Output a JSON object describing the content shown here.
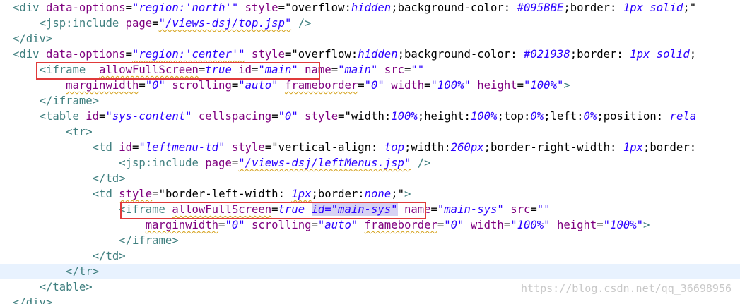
{
  "colors": {
    "tag": "#3f7f7f",
    "attribute": "#7f007f",
    "string": "#2a00ff",
    "highlight_box": "#e03a3a",
    "current_line": "#e8f2fe",
    "selection": "#d7d2f3"
  },
  "lines": [
    {
      "segments": [
        {
          "t": "<div",
          "c": "tag"
        },
        {
          "t": " "
        },
        {
          "t": "data-options",
          "c": "attr"
        },
        {
          "t": "="
        },
        {
          "t": "\"region:'north'\"",
          "c": "str"
        },
        {
          "t": " "
        },
        {
          "t": "style",
          "c": "attr"
        },
        {
          "t": "=\"overflow:"
        },
        {
          "t": "hidden",
          "c": "str"
        },
        {
          "t": ";background-color: "
        },
        {
          "t": "#095BBE",
          "c": "str"
        },
        {
          "t": ";border: "
        },
        {
          "t": "1px",
          "c": "str"
        },
        {
          "t": " "
        },
        {
          "t": "solid",
          "c": "str"
        },
        {
          "t": ";\""
        }
      ]
    },
    {
      "segments": [
        {
          "t": "    "
        },
        {
          "t": "<jsp:include",
          "c": "tag"
        },
        {
          "t": " "
        },
        {
          "t": "page",
          "c": "attr"
        },
        {
          "t": "="
        },
        {
          "t": "\"/views-dsj/top.jsp\"",
          "c": "str",
          "sq": true
        },
        {
          "t": " "
        },
        {
          "t": "/>",
          "c": "tag"
        }
      ]
    },
    {
      "segments": [
        {
          "t": "</div>",
          "c": "tag"
        }
      ]
    },
    {
      "segments": [
        {
          "t": "<div",
          "c": "tag"
        },
        {
          "t": " "
        },
        {
          "t": "data-options",
          "c": "attr"
        },
        {
          "t": "="
        },
        {
          "t": "\"region:'center'\"",
          "c": "str",
          "sq": true
        },
        {
          "t": " "
        },
        {
          "t": "style",
          "c": "attr"
        },
        {
          "t": "=\"overflow:"
        },
        {
          "t": "hidden",
          "c": "str"
        },
        {
          "t": ";background-color: "
        },
        {
          "t": "#021938",
          "c": "str"
        },
        {
          "t": ";border: "
        },
        {
          "t": "1px",
          "c": "str"
        },
        {
          "t": " "
        },
        {
          "t": "solid",
          "c": "str"
        },
        {
          "t": ";"
        }
      ]
    },
    {
      "segments": [
        {
          "t": "    "
        },
        {
          "t": "<iframe",
          "c": "tag"
        },
        {
          "t": "  "
        },
        {
          "t": "allowFullScreen",
          "c": "attr",
          "sq": true
        },
        {
          "t": "="
        },
        {
          "t": "true",
          "c": "str"
        },
        {
          "t": " "
        },
        {
          "t": "id",
          "c": "attr"
        },
        {
          "t": "="
        },
        {
          "t": "\"main\"",
          "c": "str"
        },
        {
          "t": " "
        },
        {
          "t": "name",
          "c": "attr"
        },
        {
          "t": "="
        },
        {
          "t": "\"main\"",
          "c": "str"
        },
        {
          "t": " "
        },
        {
          "t": "src",
          "c": "attr"
        },
        {
          "t": "="
        },
        {
          "t": "\"\"",
          "c": "str"
        }
      ]
    },
    {
      "segments": [
        {
          "t": "        "
        },
        {
          "t": "marginwidth",
          "c": "attr",
          "sq": true
        },
        {
          "t": "="
        },
        {
          "t": "\"0\"",
          "c": "str"
        },
        {
          "t": " "
        },
        {
          "t": "scrolling",
          "c": "attr"
        },
        {
          "t": "="
        },
        {
          "t": "\"auto\"",
          "c": "str"
        },
        {
          "t": " "
        },
        {
          "t": "frameborder",
          "c": "attr",
          "sq": true
        },
        {
          "t": "="
        },
        {
          "t": "\"0\"",
          "c": "str"
        },
        {
          "t": " "
        },
        {
          "t": "width",
          "c": "attr"
        },
        {
          "t": "="
        },
        {
          "t": "\"100%\"",
          "c": "str"
        },
        {
          "t": " "
        },
        {
          "t": "height",
          "c": "attr"
        },
        {
          "t": "="
        },
        {
          "t": "\"100%\"",
          "c": "str"
        },
        {
          "t": ">",
          "c": "tag"
        }
      ]
    },
    {
      "segments": [
        {
          "t": "    "
        },
        {
          "t": "</iframe>",
          "c": "tag"
        }
      ]
    },
    {
      "segments": [
        {
          "t": "    "
        },
        {
          "t": "<table",
          "c": "tag"
        },
        {
          "t": " "
        },
        {
          "t": "id",
          "c": "attr"
        },
        {
          "t": "="
        },
        {
          "t": "\"sys-content\"",
          "c": "str"
        },
        {
          "t": " "
        },
        {
          "t": "cellspacing",
          "c": "attr"
        },
        {
          "t": "="
        },
        {
          "t": "\"0\"",
          "c": "str"
        },
        {
          "t": " "
        },
        {
          "t": "style",
          "c": "attr"
        },
        {
          "t": "=\"width:"
        },
        {
          "t": "100%",
          "c": "str"
        },
        {
          "t": ";height:"
        },
        {
          "t": "100%",
          "c": "str"
        },
        {
          "t": ";top:"
        },
        {
          "t": "0%",
          "c": "str"
        },
        {
          "t": ";left:"
        },
        {
          "t": "0%",
          "c": "str"
        },
        {
          "t": ";position: "
        },
        {
          "t": "rela",
          "c": "str"
        }
      ]
    },
    {
      "segments": [
        {
          "t": "        "
        },
        {
          "t": "<tr>",
          "c": "tag"
        }
      ]
    },
    {
      "segments": [
        {
          "t": "            "
        },
        {
          "t": "<td",
          "c": "tag"
        },
        {
          "t": " "
        },
        {
          "t": "id",
          "c": "attr"
        },
        {
          "t": "="
        },
        {
          "t": "\"leftmenu-td\"",
          "c": "str"
        },
        {
          "t": " "
        },
        {
          "t": "style",
          "c": "attr"
        },
        {
          "t": "=\"vertical-align: "
        },
        {
          "t": "top",
          "c": "str"
        },
        {
          "t": ";width:"
        },
        {
          "t": "260px",
          "c": "str"
        },
        {
          "t": ";border-right-width: "
        },
        {
          "t": "1px",
          "c": "str"
        },
        {
          "t": ";border:"
        }
      ]
    },
    {
      "segments": [
        {
          "t": "                "
        },
        {
          "t": "<jsp:include",
          "c": "tag"
        },
        {
          "t": " "
        },
        {
          "t": "page",
          "c": "attr"
        },
        {
          "t": "="
        },
        {
          "t": "\"/views-dsj/leftMenus.jsp\"",
          "c": "str",
          "sq": true
        },
        {
          "t": " "
        },
        {
          "t": "/>",
          "c": "tag"
        }
      ]
    },
    {
      "segments": [
        {
          "t": "            "
        },
        {
          "t": "</td>",
          "c": "tag"
        }
      ]
    },
    {
      "segments": [
        {
          "t": "            "
        },
        {
          "t": "<td",
          "c": "tag"
        },
        {
          "t": " "
        },
        {
          "t": "style",
          "c": "attr",
          "sq": true
        },
        {
          "t": "=\"border-left-width: "
        },
        {
          "t": "1px",
          "c": "str",
          "sq": true
        },
        {
          "t": ";border:"
        },
        {
          "t": "none",
          "c": "str"
        },
        {
          "t": ";\""
        },
        {
          "t": ">",
          "c": "tag"
        }
      ]
    },
    {
      "segments": [
        {
          "t": "                "
        },
        {
          "t": "<iframe",
          "c": "tag"
        },
        {
          "t": " "
        },
        {
          "t": "allowFullScreen",
          "c": "attr",
          "sq": true
        },
        {
          "t": "="
        },
        {
          "t": "true",
          "c": "str"
        },
        {
          "t": " "
        },
        {
          "t": "id=\"main-sys\"",
          "c": "str",
          "hl": true
        },
        {
          "t": " "
        },
        {
          "t": "name",
          "c": "attr"
        },
        {
          "t": "="
        },
        {
          "t": "\"main-sys\"",
          "c": "str"
        },
        {
          "t": " "
        },
        {
          "t": "src",
          "c": "attr"
        },
        {
          "t": "="
        },
        {
          "t": "\"\"",
          "c": "str"
        }
      ]
    },
    {
      "segments": [
        {
          "t": "                    "
        },
        {
          "t": "marginwidth",
          "c": "attr",
          "sq": true
        },
        {
          "t": "="
        },
        {
          "t": "\"0\"",
          "c": "str"
        },
        {
          "t": " "
        },
        {
          "t": "scrolling",
          "c": "attr"
        },
        {
          "t": "="
        },
        {
          "t": "\"auto\"",
          "c": "str"
        },
        {
          "t": " "
        },
        {
          "t": "frameborder",
          "c": "attr",
          "sq": true
        },
        {
          "t": "="
        },
        {
          "t": "\"0\"",
          "c": "str"
        },
        {
          "t": " "
        },
        {
          "t": "width",
          "c": "attr"
        },
        {
          "t": "="
        },
        {
          "t": "\"100%\"",
          "c": "str"
        },
        {
          "t": " "
        },
        {
          "t": "height",
          "c": "attr"
        },
        {
          "t": "="
        },
        {
          "t": "\"100%\"",
          "c": "str"
        },
        {
          "t": ">",
          "c": "tag"
        }
      ]
    },
    {
      "segments": [
        {
          "t": "                "
        },
        {
          "t": "</iframe>",
          "c": "tag"
        }
      ]
    },
    {
      "segments": [
        {
          "t": "            "
        },
        {
          "t": "</td>",
          "c": "tag"
        }
      ]
    },
    {
      "segments": [
        {
          "t": "        "
        },
        {
          "t": "</tr>",
          "c": "tag"
        }
      ],
      "current": true
    },
    {
      "segments": [
        {
          "t": "    "
        },
        {
          "t": "</table>",
          "c": "tag"
        }
      ]
    },
    {
      "segments": [
        {
          "t": "</div>",
          "c": "tag"
        }
      ]
    }
  ],
  "annotations": [
    "iframe-main-box",
    "iframe-main-sys-box"
  ],
  "watermark": "https://blog.csdn.net/qq_36698956"
}
